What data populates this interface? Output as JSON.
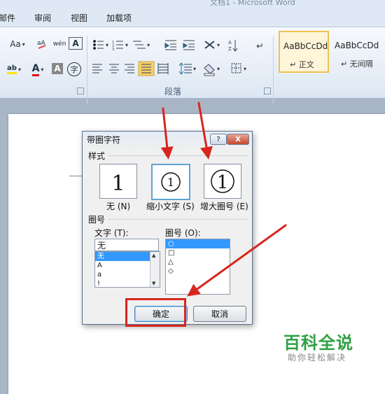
{
  "window": {
    "title": "文档1 - Microsoft Word"
  },
  "tabs": [
    {
      "label": "邮件"
    },
    {
      "label": "审阅"
    },
    {
      "label": "视图"
    },
    {
      "label": "加载项"
    }
  ],
  "ribbon": {
    "font_row1": [
      "Aa",
      "wén",
      "A"
    ],
    "font_row2": [
      "ab",
      "A",
      "A",
      "字"
    ],
    "paragraph_group_label": "段落",
    "styles": [
      {
        "preview": "AaBbCcDd",
        "name": "↵ 正文"
      },
      {
        "preview": "AaBbCcDd",
        "name": "↵ 无间隔"
      }
    ]
  },
  "dialog": {
    "title": "带圈字符",
    "help_button": "?",
    "close_button": "X",
    "style_section": "样式",
    "style_options": [
      {
        "glyph": "1",
        "label": "无 (N)"
      },
      {
        "glyph": "①",
        "label": "缩小文字 (S)"
      },
      {
        "glyph": "①",
        "label": "增大圈号 (E)"
      }
    ],
    "ring_section": "圈号",
    "text_label": "文字 (T):",
    "text_value": "无",
    "text_list": [
      "无",
      "A",
      "a",
      "!"
    ],
    "ring_label": "圈号 (O):",
    "ring_list": [
      "○",
      "□",
      "△",
      "◇"
    ],
    "ok_label": "确定",
    "cancel_label": "取消"
  },
  "watermark": {
    "title": "百科全说",
    "subtitle": "助你轻松解决"
  },
  "colors": {
    "annotation_red": "#d7261e",
    "selection_blue": "#3399ff",
    "watermark_green": "#2ea043"
  }
}
